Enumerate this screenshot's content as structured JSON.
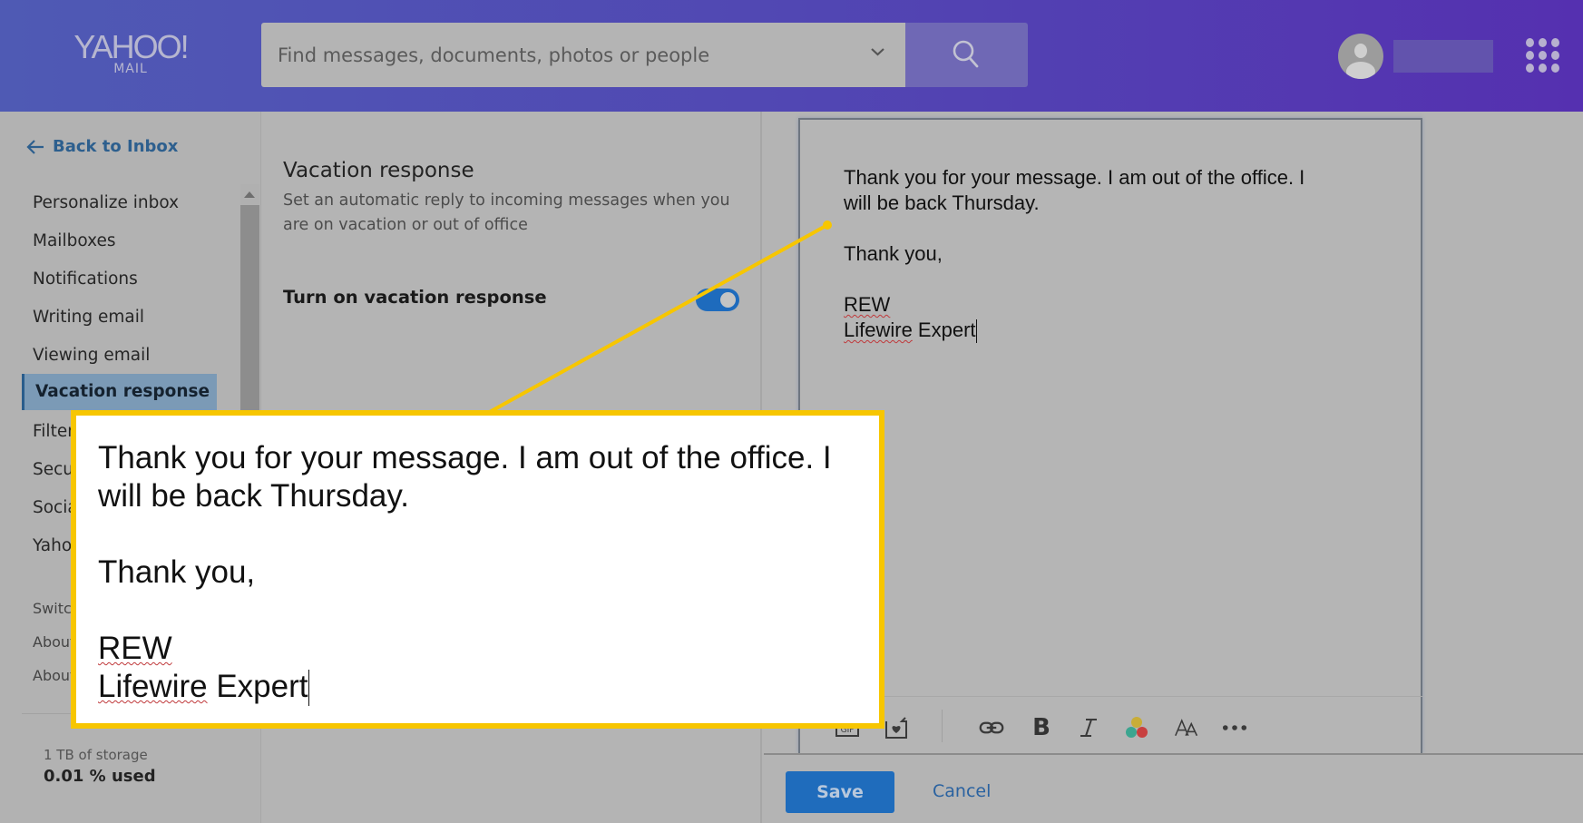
{
  "header": {
    "logo_main": "YAHOO!",
    "logo_sub": "MAIL",
    "search_placeholder": "Find messages, documents, photos or people",
    "search_value": "",
    "icons": [
      "chevron-down-icon",
      "search-icon",
      "avatar-icon",
      "apps-grid-icon"
    ]
  },
  "sidebar": {
    "back_label": "Back to Inbox",
    "items": [
      {
        "label": "Personalize inbox",
        "active": false
      },
      {
        "label": "Mailboxes",
        "active": false
      },
      {
        "label": "Notifications",
        "active": false
      },
      {
        "label": "Writing email",
        "active": false
      },
      {
        "label": "Viewing email",
        "active": false
      },
      {
        "label": "Vacation response",
        "active": true
      },
      {
        "label": "Filters",
        "active": false
      },
      {
        "label": "Security",
        "active": false
      },
      {
        "label": "Social",
        "active": false
      },
      {
        "label": "Yahoo",
        "active": false
      }
    ],
    "secondary_items": [
      {
        "label": "Switch"
      },
      {
        "label": "About"
      },
      {
        "label": "About"
      }
    ],
    "storage": {
      "capacity": "1 TB of storage",
      "used": "0.01 % used"
    }
  },
  "settings": {
    "title": "Vacation response",
    "description": "Set an automatic reply to incoming messages when you are on vacation or out of office",
    "toggle_label": "Turn on vacation response",
    "toggle_on": true,
    "toggle_color": "#1e6bbd"
  },
  "compose": {
    "line1": "Thank you for your message. I am out of the office. I",
    "line2": "will be back Thursday.",
    "line3": "Thank you,",
    "sig_name": "REW",
    "sig_title_misspelled": "Lifewire",
    "sig_title_rest": " Expert",
    "toolbar": [
      {
        "name": "gif-icon",
        "label": "GIF"
      },
      {
        "name": "card-icon",
        "label": ""
      },
      {
        "name": "link-icon",
        "label": ""
      },
      {
        "name": "bold-icon",
        "label": "B"
      },
      {
        "name": "italic-icon",
        "label": "I"
      },
      {
        "name": "color-icon",
        "label": ""
      },
      {
        "name": "font-size-icon",
        "label": "AA"
      },
      {
        "name": "more-icon",
        "label": "•••"
      }
    ]
  },
  "footer": {
    "save_label": "Save",
    "cancel_label": "Cancel"
  },
  "callout": {
    "line1": "Thank you for your message. I am out of the office. I",
    "line2": "will be back Thursday.",
    "line3": "Thank you,",
    "sig_name": "REW",
    "sig_title_misspelled": "Lifewire",
    "sig_title_rest": " Expert",
    "border_color": "#f7c600"
  }
}
